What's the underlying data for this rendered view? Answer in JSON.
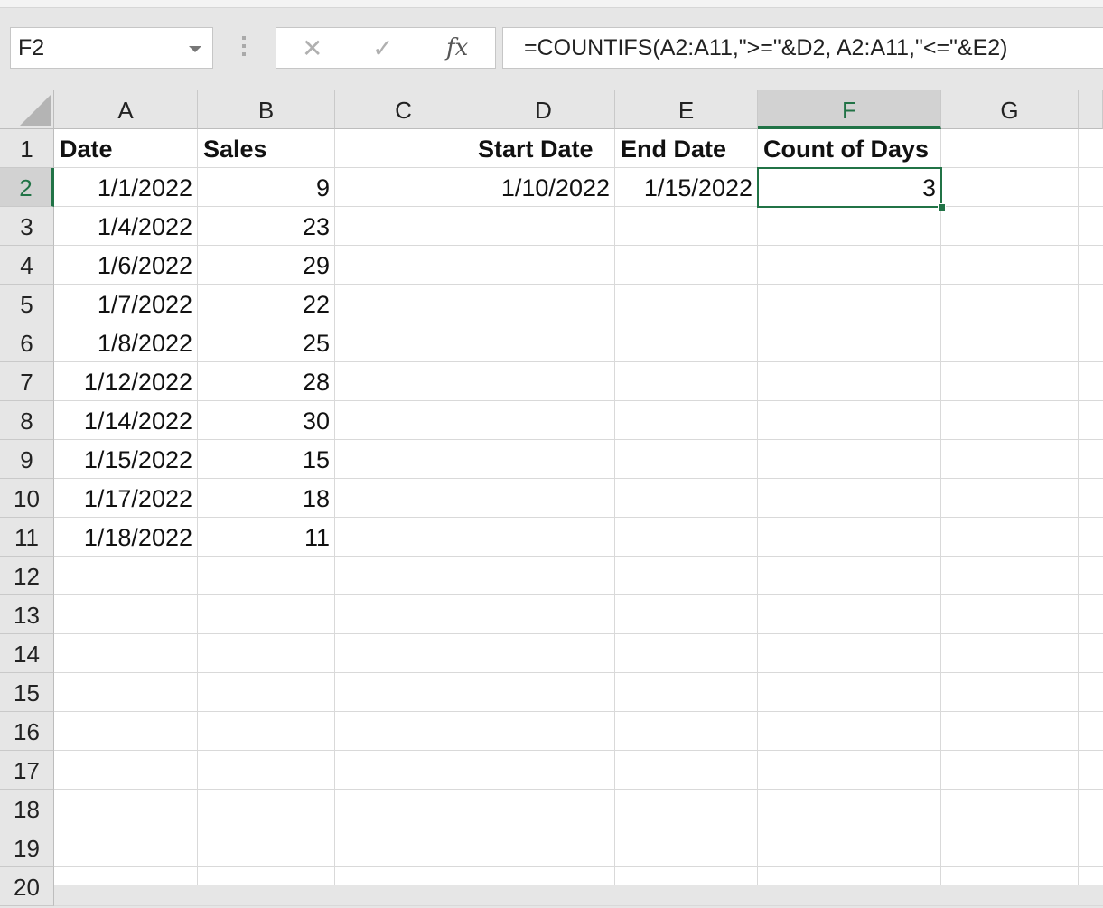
{
  "name_box": {
    "value": "F2",
    "dropdown_icon": "chevron-down-icon"
  },
  "formula_bar": {
    "cancel_icon": "close-icon",
    "enter_icon": "check-icon",
    "function_icon": "fx-icon",
    "function_label": "fx",
    "formula": "=COUNTIFS(A2:A11,\">=\"&D2, A2:A11,\"<=\"&E2)"
  },
  "columns": [
    "A",
    "B",
    "C",
    "D",
    "E",
    "F",
    "G"
  ],
  "selected_column": "F",
  "selected_row": "2",
  "rows": [
    "1",
    "2",
    "3",
    "4",
    "5",
    "6",
    "7",
    "8",
    "9",
    "10",
    "11",
    "12",
    "13",
    "14",
    "15",
    "16",
    "17",
    "18",
    "19",
    "20"
  ],
  "headers": {
    "A1": "Date",
    "B1": "Sales",
    "D1": "Start Date",
    "E1": "End Date",
    "F1": "Count of Days"
  },
  "data": [
    {
      "date": "1/1/2022",
      "sales": "9"
    },
    {
      "date": "1/4/2022",
      "sales": "23"
    },
    {
      "date": "1/6/2022",
      "sales": "29"
    },
    {
      "date": "1/7/2022",
      "sales": "22"
    },
    {
      "date": "1/8/2022",
      "sales": "25"
    },
    {
      "date": "1/12/2022",
      "sales": "28"
    },
    {
      "date": "1/14/2022",
      "sales": "30"
    },
    {
      "date": "1/15/2022",
      "sales": "15"
    },
    {
      "date": "1/17/2022",
      "sales": "18"
    },
    {
      "date": "1/18/2022",
      "sales": "11"
    }
  ],
  "criteria": {
    "start_date": "1/10/2022",
    "end_date": "1/15/2022",
    "count_of_days": "3"
  },
  "colors": {
    "accent": "#217346"
  }
}
